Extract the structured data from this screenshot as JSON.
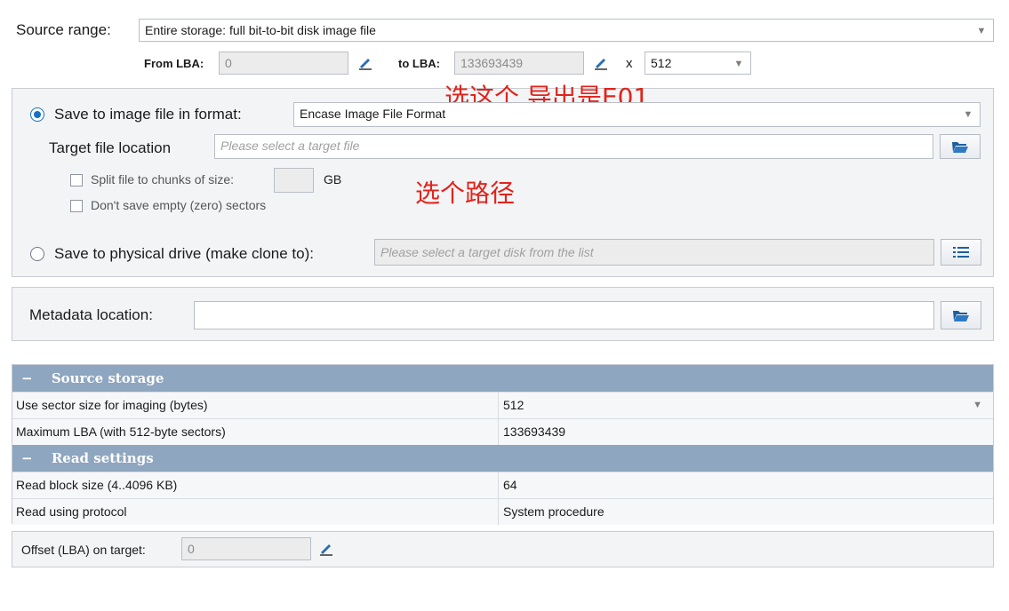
{
  "source": {
    "label": "Source range:",
    "range_value": "Entire storage: full bit-to-bit disk image file",
    "from_label": "From LBA:",
    "from_value": "0",
    "to_label": "to LBA:",
    "to_value": "133693439",
    "x_label": "x",
    "sector_value": "512"
  },
  "image": {
    "radio_label": "Save to image file in format:",
    "format_value": "Encase Image File Format",
    "target_label": "Target file location",
    "target_placeholder": "Please select a target file",
    "split_label": "Split file to chunks of size:",
    "split_value": "",
    "split_unit": "GB",
    "empty_label": "Don't save empty (zero) sectors"
  },
  "physical": {
    "radio_label": "Save to physical drive (make clone to):",
    "placeholder": "Please select a target disk from the list"
  },
  "metadata": {
    "label": "Metadata location:",
    "value": ""
  },
  "annotations": {
    "format_note": "选这个 导出是E01",
    "path_note": "选个路径"
  },
  "grid": {
    "source_storage_header": "Source storage",
    "read_settings_header": "Read settings",
    "collapse_symbol": "−",
    "rows_source": [
      {
        "name": "Use sector size for imaging (bytes)",
        "value": "512"
      },
      {
        "name": "Maximum LBA (with 512-byte sectors)",
        "value": "133693439"
      }
    ],
    "rows_read": [
      {
        "name": "Read block size (4..4096 KB)",
        "value": "64"
      },
      {
        "name": "Read using protocol",
        "value": "System procedure"
      }
    ]
  },
  "offset": {
    "label": "Offset (LBA) on target:",
    "value": "0"
  },
  "colors": {
    "accent": "#1672c4",
    "grid_header": "#8ea6bf",
    "annotation": "#e0241b"
  }
}
